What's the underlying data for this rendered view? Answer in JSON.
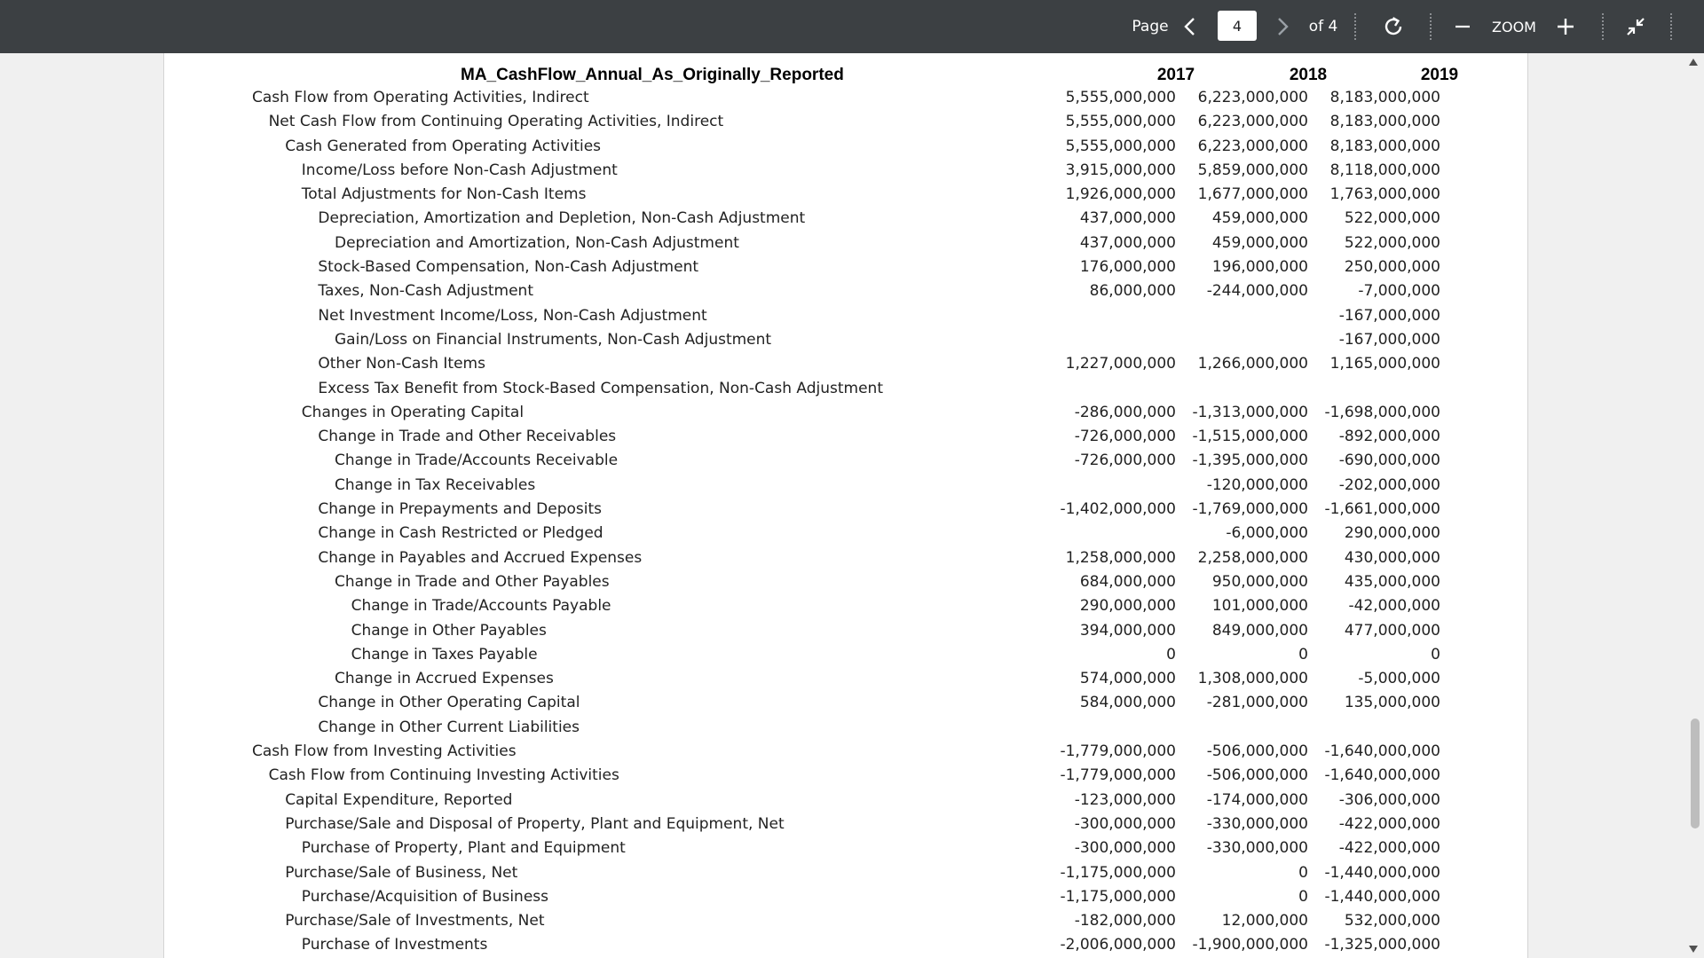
{
  "toolbar": {
    "page_label": "Page",
    "current_page": "4",
    "page_total_label": "of 4",
    "zoom_label": "ZOOM",
    "icons": {
      "prev": "chevron-left-icon",
      "next": "chevron-right-icon",
      "rotate": "rotate-icon",
      "zoom_out": "minus-icon",
      "zoom_in": "plus-icon",
      "collapse": "collapse-icon"
    }
  },
  "document": {
    "title": "MA_CashFlow_Annual_As_Originally_Reported",
    "years": [
      "2017",
      "2018",
      "2019"
    ],
    "rows": [
      {
        "label": "Cash Flow from Operating Activities, Indirect",
        "level": 0,
        "values": [
          "5,555,000,000",
          "6,223,000,000",
          "8,183,000,000"
        ]
      },
      {
        "label": "Net Cash Flow from Continuing Operating Activities, Indirect",
        "level": 1,
        "values": [
          "5,555,000,000",
          "6,223,000,000",
          "8,183,000,000"
        ]
      },
      {
        "label": "Cash Generated from Operating Activities",
        "level": 2,
        "values": [
          "5,555,000,000",
          "6,223,000,000",
          "8,183,000,000"
        ]
      },
      {
        "label": "Income/Loss before Non-Cash Adjustment",
        "level": 3,
        "values": [
          "3,915,000,000",
          "5,859,000,000",
          "8,118,000,000"
        ]
      },
      {
        "label": "Total Adjustments for Non-Cash Items",
        "level": 3,
        "values": [
          "1,926,000,000",
          "1,677,000,000",
          "1,763,000,000"
        ]
      },
      {
        "label": "Depreciation, Amortization and Depletion, Non-Cash Adjustment",
        "level": 4,
        "values": [
          "437,000,000",
          "459,000,000",
          "522,000,000"
        ]
      },
      {
        "label": "Depreciation and Amortization, Non-Cash Adjustment",
        "level": 5,
        "values": [
          "437,000,000",
          "459,000,000",
          "522,000,000"
        ]
      },
      {
        "label": "Stock-Based Compensation, Non-Cash Adjustment",
        "level": 4,
        "values": [
          "176,000,000",
          "196,000,000",
          "250,000,000"
        ]
      },
      {
        "label": "Taxes, Non-Cash Adjustment",
        "level": 4,
        "values": [
          "86,000,000",
          "-244,000,000",
          "-7,000,000"
        ]
      },
      {
        "label": "Net Investment Income/Loss, Non-Cash Adjustment",
        "level": 4,
        "values": [
          "",
          "",
          "-167,000,000"
        ]
      },
      {
        "label": "Gain/Loss on Financial Instruments, Non-Cash Adjustment",
        "level": 5,
        "values": [
          "",
          "",
          "-167,000,000"
        ]
      },
      {
        "label": "Other Non-Cash Items",
        "level": 4,
        "values": [
          "1,227,000,000",
          "1,266,000,000",
          "1,165,000,000"
        ]
      },
      {
        "label": "Excess Tax Benefit from Stock-Based Compensation, Non-Cash Adjustment",
        "level": 4,
        "values": [
          "",
          "",
          ""
        ]
      },
      {
        "label": "Changes in Operating Capital",
        "level": 3,
        "values": [
          "-286,000,000",
          "-1,313,000,000",
          "-1,698,000,000"
        ]
      },
      {
        "label": "Change in Trade and Other Receivables",
        "level": 4,
        "values": [
          "-726,000,000",
          "-1,515,000,000",
          "-892,000,000"
        ]
      },
      {
        "label": "Change in Trade/Accounts Receivable",
        "level": 5,
        "values": [
          "-726,000,000",
          "-1,395,000,000",
          "-690,000,000"
        ]
      },
      {
        "label": "Change in Tax Receivables",
        "level": 5,
        "values": [
          "",
          "-120,000,000",
          "-202,000,000"
        ]
      },
      {
        "label": "Change in Prepayments and Deposits",
        "level": 4,
        "values": [
          "-1,402,000,000",
          "-1,769,000,000",
          "-1,661,000,000"
        ]
      },
      {
        "label": "Change in Cash Restricted or Pledged",
        "level": 4,
        "values": [
          "",
          "-6,000,000",
          "290,000,000"
        ]
      },
      {
        "label": "Change in Payables and Accrued Expenses",
        "level": 4,
        "values": [
          "1,258,000,000",
          "2,258,000,000",
          "430,000,000"
        ]
      },
      {
        "label": "Change in Trade and Other Payables",
        "level": 5,
        "values": [
          "684,000,000",
          "950,000,000",
          "435,000,000"
        ]
      },
      {
        "label": "Change in Trade/Accounts Payable",
        "level": 6,
        "values": [
          "290,000,000",
          "101,000,000",
          "-42,000,000"
        ]
      },
      {
        "label": "Change in Other Payables",
        "level": 6,
        "values": [
          "394,000,000",
          "849,000,000",
          "477,000,000"
        ]
      },
      {
        "label": "Change in Taxes Payable",
        "level": 6,
        "values": [
          "0",
          "0",
          "0"
        ]
      },
      {
        "label": "Change in Accrued Expenses",
        "level": 5,
        "values": [
          "574,000,000",
          "1,308,000,000",
          "-5,000,000"
        ]
      },
      {
        "label": "Change in Other Operating Capital",
        "level": 4,
        "values": [
          "584,000,000",
          "-281,000,000",
          "135,000,000"
        ]
      },
      {
        "label": "Change in Other Current Liabilities",
        "level": 4,
        "values": [
          "",
          "",
          ""
        ]
      },
      {
        "label": "Cash Flow from Investing Activities",
        "level": 0,
        "values": [
          "-1,779,000,000",
          "-506,000,000",
          "-1,640,000,000"
        ]
      },
      {
        "label": "Cash Flow from Continuing Investing Activities",
        "level": 1,
        "values": [
          "-1,779,000,000",
          "-506,000,000",
          "-1,640,000,000"
        ]
      },
      {
        "label": "Capital Expenditure, Reported",
        "level": 2,
        "values": [
          "-123,000,000",
          "-174,000,000",
          "-306,000,000"
        ]
      },
      {
        "label": "Purchase/Sale and Disposal of Property, Plant and Equipment, Net",
        "level": 2,
        "values": [
          "-300,000,000",
          "-330,000,000",
          "-422,000,000"
        ]
      },
      {
        "label": "Purchase of Property, Plant and Equipment",
        "level": 3,
        "values": [
          "-300,000,000",
          "-330,000,000",
          "-422,000,000"
        ]
      },
      {
        "label": "Purchase/Sale of Business, Net",
        "level": 2,
        "values": [
          "-1,175,000,000",
          "0",
          "-1,440,000,000"
        ]
      },
      {
        "label": "Purchase/Acquisition of Business",
        "level": 3,
        "values": [
          "-1,175,000,000",
          "0",
          "-1,440,000,000"
        ]
      },
      {
        "label": "Purchase/Sale of Investments, Net",
        "level": 2,
        "values": [
          "-182,000,000",
          "12,000,000",
          "532,000,000"
        ]
      },
      {
        "label": "Purchase of Investments",
        "level": 3,
        "values": [
          "-2,006,000,000",
          "-1,900,000,000",
          "-1,325,000,000"
        ]
      }
    ]
  }
}
